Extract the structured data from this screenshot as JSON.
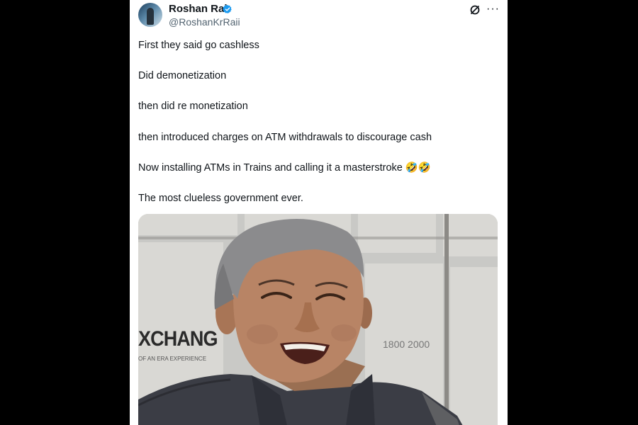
{
  "author": {
    "name": "Roshan Rai",
    "handle": "@RoshanKrRaii",
    "verified": true
  },
  "tweet": {
    "lines": [
      "First they said go cashless",
      "Did demonetization",
      "then did re monetization",
      "then introduced charges on ATM withdrawals to discourage cash",
      "Now installing ATMs in Trains and calling it a masterstroke 🤣🤣",
      "The most clueless government ever."
    ]
  },
  "media": {
    "sign_text": "XCHANG",
    "sign_subtext": "OF AN ERA EXPERIENCE",
    "sign_number": "1800 2000"
  },
  "colors": {
    "verified_badge": "#1d9bf0",
    "text_primary": "#0f1419",
    "text_secondary": "#536471",
    "background": "#000000",
    "card": "#ffffff"
  },
  "icons": {
    "verified": "verified-badge-icon",
    "grok": "grok-icon",
    "more": "more-options-icon"
  }
}
